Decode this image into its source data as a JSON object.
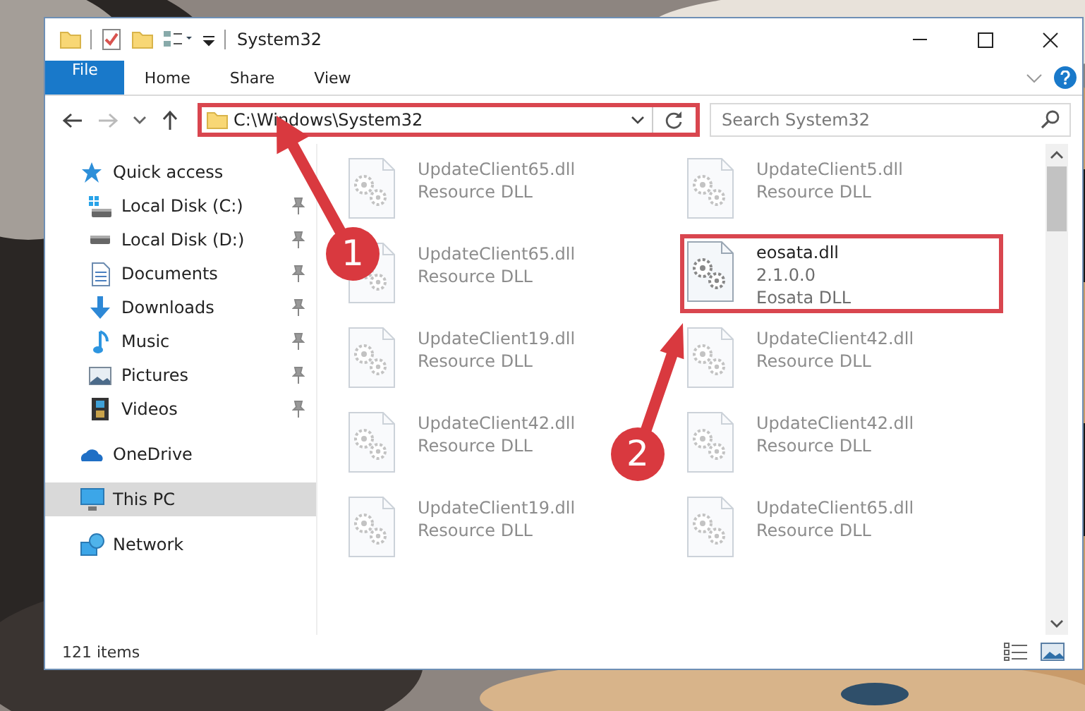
{
  "window": {
    "title": "System32"
  },
  "ribbon_tabs": [
    {
      "label": "File",
      "kind": "file"
    },
    {
      "label": "Home",
      "kind": "tab"
    },
    {
      "label": "Share",
      "kind": "tab"
    },
    {
      "label": "View",
      "kind": "tab"
    }
  ],
  "address": {
    "path": "C:\\Windows\\System32",
    "highlighted": true
  },
  "search": {
    "placeholder": "Search System32"
  },
  "nav": [
    {
      "label": "Quick access",
      "kind": "star",
      "selected": false,
      "children": [
        {
          "label": "Local Disk (C:)",
          "kind": "system-disk",
          "selected": false,
          "pinned": true
        },
        {
          "label": "Local Disk (D:)",
          "kind": "disk",
          "selected": false,
          "pinned": true
        },
        {
          "label": "Documents",
          "kind": "documents",
          "selected": false,
          "pinned": true
        },
        {
          "label": "Downloads",
          "kind": "downloads",
          "selected": false,
          "pinned": true
        },
        {
          "label": "Music",
          "kind": "music",
          "selected": false,
          "pinned": true
        },
        {
          "label": "Pictures",
          "kind": "pictures",
          "selected": false,
          "pinned": true
        },
        {
          "label": "Videos",
          "kind": "videos",
          "selected": false,
          "pinned": true
        }
      ]
    },
    {
      "label": "OneDrive",
      "kind": "cloud",
      "selected": false
    },
    {
      "label": "This PC",
      "kind": "computer",
      "selected": true
    },
    {
      "label": "Network",
      "kind": "network",
      "selected": false
    }
  ],
  "files": [
    {
      "name": "UpdateClient65.dll",
      "type": "Resource DLL",
      "blurred": true,
      "highlighted": false
    },
    {
      "name": "UpdateClient5.dll",
      "type": "Resource DLL",
      "blurred": true,
      "highlighted": false
    },
    {
      "name": "UpdateClient65.dll",
      "type": "Resource DLL",
      "blurred": true,
      "highlighted": false
    },
    {
      "name": "eosata.dll",
      "version": "2.1.0.0",
      "type": "Eosata DLL",
      "blurred": false,
      "highlighted": true
    },
    {
      "name": "UpdateClient19.dll",
      "type": "Resource DLL",
      "blurred": true,
      "highlighted": false
    },
    {
      "name": "UpdateClient42.dll",
      "type": "Resource DLL",
      "blurred": true,
      "highlighted": false
    },
    {
      "name": "UpdateClient42.dll",
      "type": "Resource DLL",
      "blurred": true,
      "highlighted": false
    },
    {
      "name": "UpdateClient42.dll",
      "type": "Resource DLL",
      "blurred": true,
      "highlighted": false
    },
    {
      "name": "UpdateClient19.dll",
      "type": "Resource DLL",
      "blurred": true,
      "highlighted": false
    },
    {
      "name": "UpdateClient65.dll",
      "type": "Resource DLL",
      "blurred": true,
      "highlighted": false
    }
  ],
  "status_bar": {
    "item_count": "121 items"
  },
  "annotations": [
    {
      "label": "1"
    },
    {
      "label": "2"
    }
  ]
}
